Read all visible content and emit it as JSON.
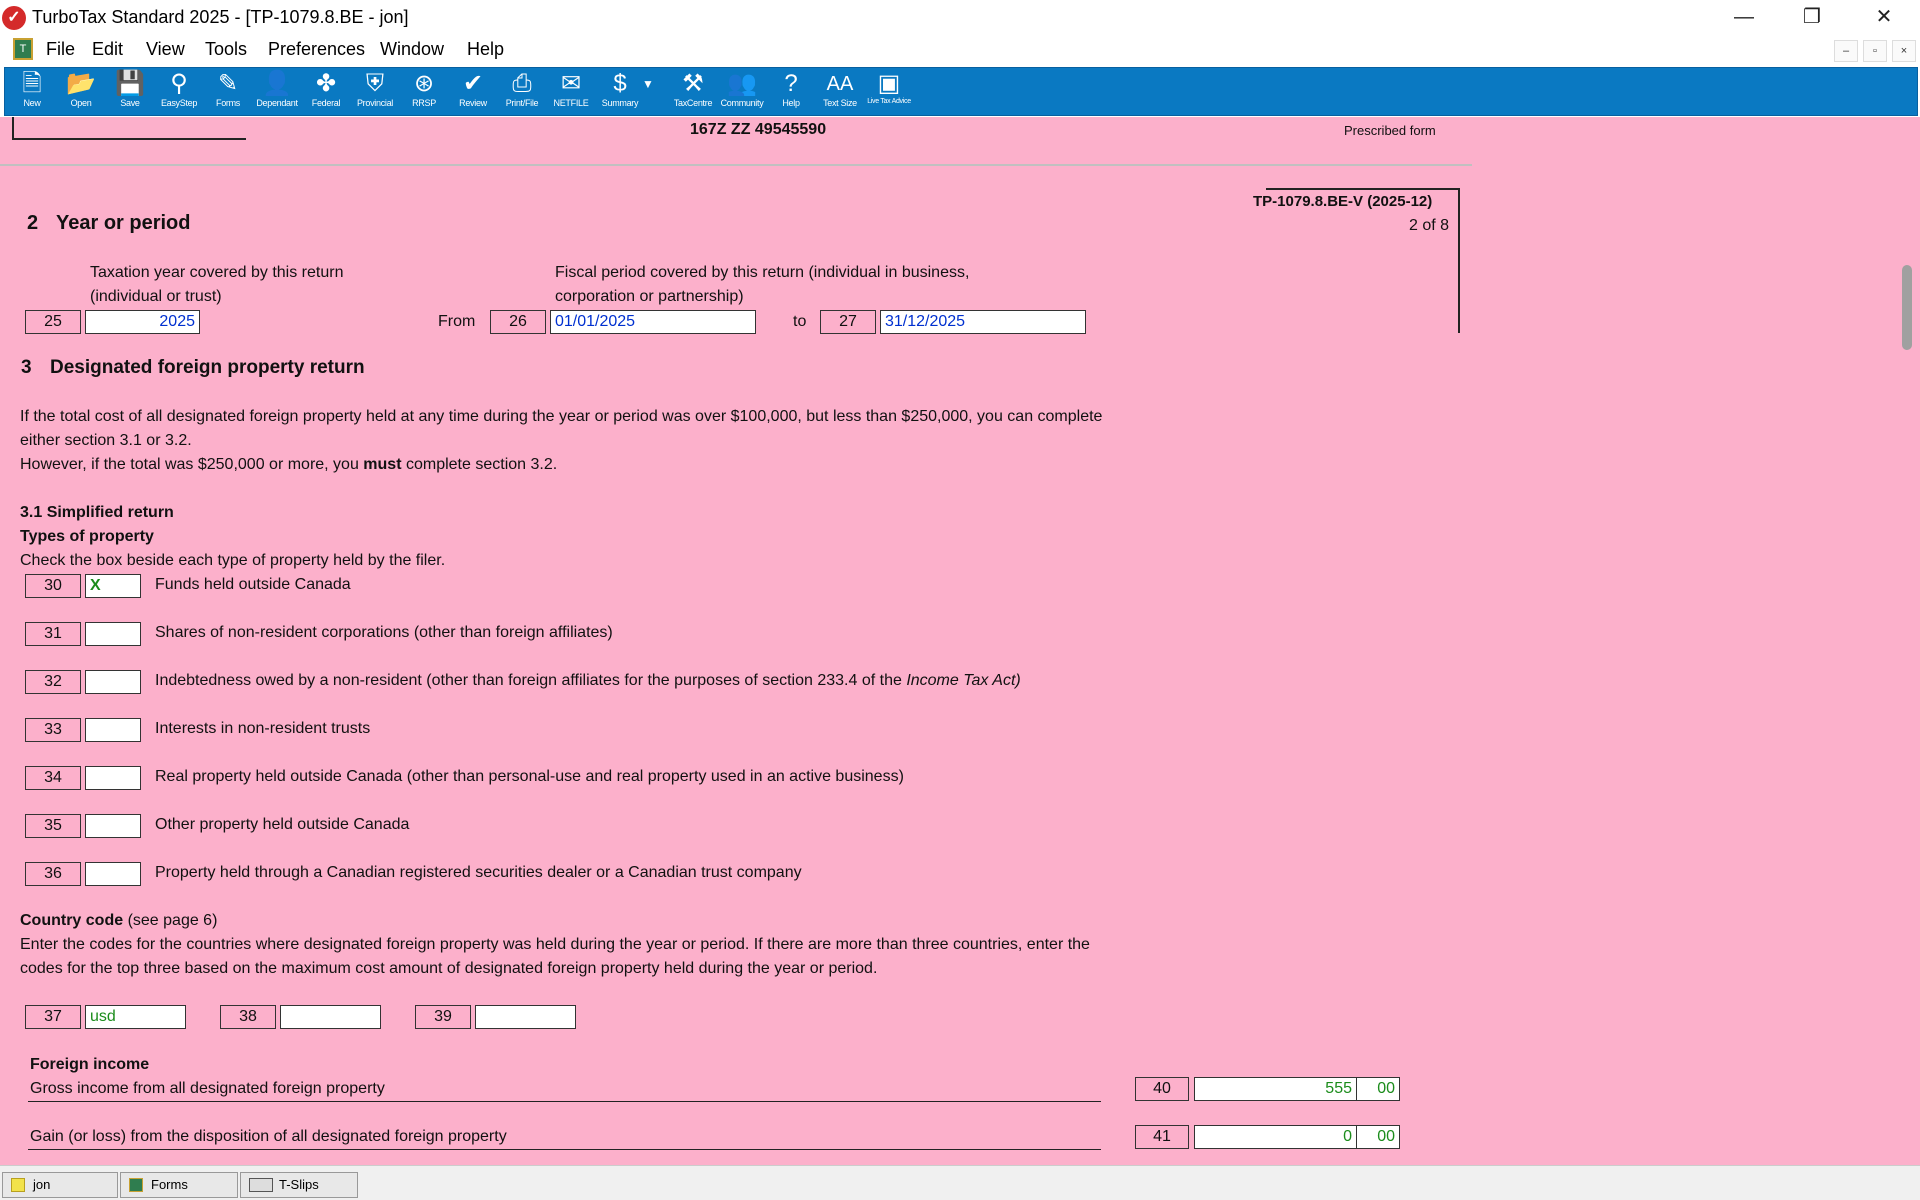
{
  "window": {
    "title": "TurboTax Standard 2025 - [TP-1079.8.BE - jon]",
    "minimize": "—",
    "restore": "❐",
    "close": "✕"
  },
  "menu": {
    "items": [
      "File",
      "Edit",
      "View",
      "Tools",
      "Preferences",
      "Window",
      "Help"
    ]
  },
  "mdi": {
    "min": "–",
    "restore": "▫",
    "close": "×"
  },
  "toolbar": {
    "buttons": [
      {
        "label": "New",
        "icon": "new-icon"
      },
      {
        "label": "Open",
        "icon": "open-icon"
      },
      {
        "label": "Save",
        "icon": "save-icon"
      },
      {
        "label": "EasyStep",
        "icon": "easystep-icon"
      },
      {
        "label": "Forms",
        "icon": "forms-icon"
      },
      {
        "label": "Dependant",
        "icon": "dependant-icon"
      },
      {
        "label": "Federal",
        "icon": "federal-icon"
      },
      {
        "label": "Provincial",
        "icon": "provincial-icon"
      },
      {
        "label": "RRSP",
        "icon": "rrsp-icon"
      },
      {
        "label": "Review",
        "icon": "review-icon"
      },
      {
        "label": "Print/File",
        "icon": "print-icon"
      },
      {
        "label": "NETFILE",
        "icon": "netfile-icon"
      },
      {
        "label": "Summary",
        "icon": "summary-icon"
      },
      {
        "label": "TaxCentre",
        "icon": "taxcentre-icon"
      },
      {
        "label": "Community",
        "icon": "community-icon"
      },
      {
        "label": "Help",
        "icon": "help-icon"
      },
      {
        "label": "Text Size",
        "icon": "textsize-icon"
      },
      {
        "label": "Live Tax Advice",
        "icon": "livetax-icon"
      }
    ]
  },
  "form": {
    "account_number": "167Z ZZ 49545590",
    "prescribed": "Prescribed form",
    "form_id": "TP-1079.8.BE-V (2025-12)",
    "page": "2 of 8",
    "s2_num": "2",
    "s2_title": "Year or period",
    "tax_year_label1": "Taxation year covered by this return",
    "tax_year_label2": "(individual or trust)",
    "fiscal_label1": "Fiscal period covered by this return (individual in business,",
    "fiscal_label2": "corporation or partnership)",
    "line25": "25",
    "tax_year": "2025",
    "from": "From",
    "line26": "26",
    "from_date": "01/01/2025",
    "to": "to",
    "line27": "27",
    "to_date": "31/12/2025",
    "s3_num": "3",
    "s3_title": "Designated foreign property return",
    "intro1": "If the total cost of all designated foreign property held at any time during the year or period was over $100,000, but less than $250,000, you can complete",
    "intro2": "either section 3.1 or 3.2.",
    "intro3a": "However, if the total was $250,000 or more, you ",
    "intro3b": "must",
    "intro3c": " complete section 3.2.",
    "s31_title": "3.1   Simplified return",
    "types_title": "Types of property",
    "types_instr": "Check the box beside each type of property held by the filer.",
    "property_rows": [
      {
        "line": "30",
        "value": "X",
        "text": "Funds held outside Canada"
      },
      {
        "line": "31",
        "value": "",
        "text": "Shares of non-resident corporations (other than foreign affiliates)"
      },
      {
        "line": "32",
        "value": "",
        "text": "Indebtedness owed by a non-resident (other than foreign affiliates for the purposes of section 233.4 of the "
      },
      {
        "line": "33",
        "value": "",
        "text": "Interests in non-resident trusts"
      },
      {
        "line": "34",
        "value": "",
        "text": "Real property held outside Canada (other than personal-use and real property used in an active business)"
      },
      {
        "line": "35",
        "value": "",
        "text": "Other property held outside Canada"
      },
      {
        "line": "36",
        "value": "",
        "text": "Property held through a Canadian registered securities dealer or a Canadian trust company"
      }
    ],
    "row32_italic": "Income Tax Act)",
    "country_title": "Country code",
    "country_see": " (see page 6)",
    "country_instr1": "Enter the codes for the countries where designated foreign property was held during the year or period. If there are more than three countries, enter the",
    "country_instr2": "codes for the top three based on the maximum cost amount of designated foreign property held during the year or period.",
    "line37": "37",
    "country1": "usd",
    "line38": "38",
    "country2": "",
    "line39": "39",
    "country3": "",
    "income_title": "Foreign income",
    "gross_label": "Gross income from all designated foreign property",
    "line40": "40",
    "gross_dollars": "555",
    "gross_cents": "00",
    "gain_label": "Gain (or loss) from the disposition of all designated foreign property",
    "line41": "41",
    "gain_dollars": "0",
    "gain_cents": "00"
  },
  "status_tabs": [
    {
      "label": "jon",
      "icon": "user-icon"
    },
    {
      "label": "Forms",
      "icon": "forms-icon"
    },
    {
      "label": "T-Slips",
      "icon": "tslips-icon"
    }
  ]
}
